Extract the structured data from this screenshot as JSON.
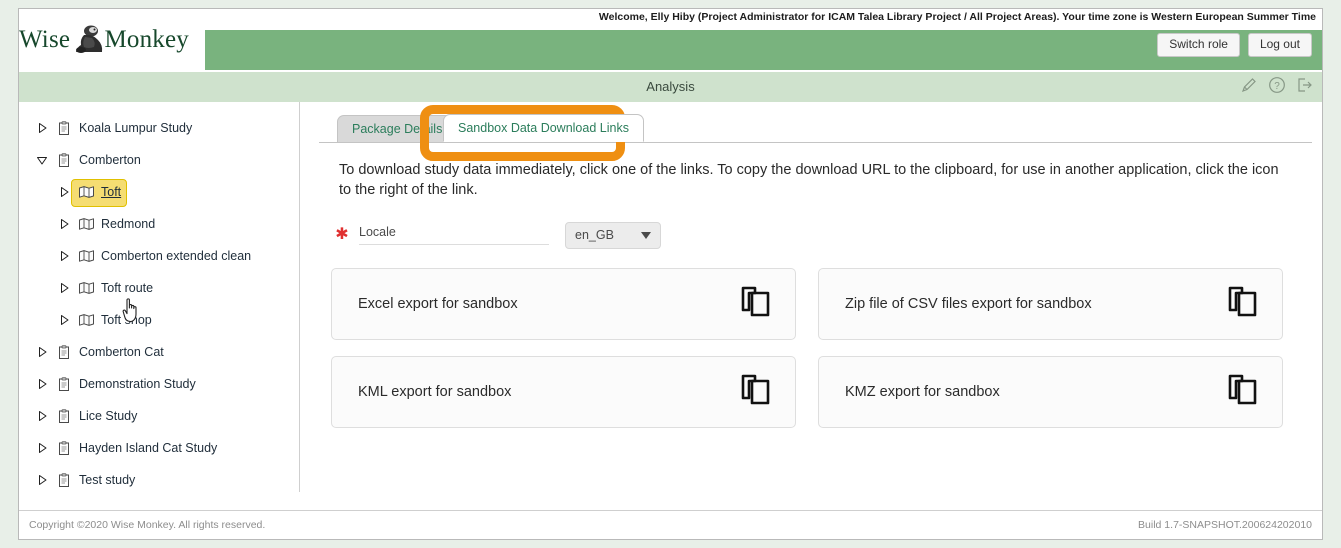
{
  "brand": {
    "name_part1": "Wise",
    "name_part2": "Monkey",
    "logo_icon": "monkey-logo-icon"
  },
  "header": {
    "welcome_text": "Welcome, Elly Hiby (Project Administrator for ICAM Talea Library Project / All Project Areas). Your time zone is Western European Summer Time",
    "switch_role_label": "Switch role",
    "log_out_label": "Log out",
    "green_color": "#79b37e"
  },
  "title_bar": {
    "title": "Analysis",
    "background_color": "#cfe2cd",
    "icons": [
      {
        "name": "edit-pencil-icon"
      },
      {
        "name": "help-question-icon"
      },
      {
        "name": "exit-arrow-icon"
      }
    ]
  },
  "sidebar": {
    "items": [
      {
        "label": "Koala Lumpur Study",
        "level": 1,
        "expanded": false,
        "icon": "study-clipboard-icon",
        "selected": false
      },
      {
        "label": "Comberton",
        "level": 1,
        "expanded": true,
        "icon": "study-clipboard-icon",
        "selected": false
      },
      {
        "label": "Toft",
        "level": 2,
        "expanded": false,
        "icon": "map-package-icon",
        "selected": true
      },
      {
        "label": "Redmond",
        "level": 2,
        "expanded": false,
        "icon": "map-package-icon",
        "selected": false
      },
      {
        "label": "Comberton extended clean",
        "level": 2,
        "expanded": false,
        "icon": "map-package-icon",
        "selected": false
      },
      {
        "label": "Toft route",
        "level": 2,
        "expanded": false,
        "icon": "map-package-icon",
        "selected": false
      },
      {
        "label": "Toft shop",
        "level": 2,
        "expanded": false,
        "icon": "map-package-icon",
        "selected": false
      },
      {
        "label": "Comberton Cat",
        "level": 1,
        "expanded": false,
        "icon": "study-clipboard-icon",
        "selected": false
      },
      {
        "label": "Demonstration Study",
        "level": 1,
        "expanded": false,
        "icon": "study-clipboard-icon",
        "selected": false
      },
      {
        "label": "Lice Study",
        "level": 1,
        "expanded": false,
        "icon": "study-clipboard-icon",
        "selected": false
      },
      {
        "label": "Hayden Island Cat Study",
        "level": 1,
        "expanded": false,
        "icon": "study-clipboard-icon",
        "selected": false
      },
      {
        "label": "Test study",
        "level": 1,
        "expanded": false,
        "icon": "study-clipboard-icon",
        "selected": false
      }
    ],
    "selection_color": "#f5dd72",
    "cursor": "pointing-hand-cursor"
  },
  "tabs": {
    "inactive_label": "Package Details",
    "active_label": "Sandbox Data Download Links",
    "highlight_color": "#ef8f12"
  },
  "main": {
    "instructions": "To download study data immediately, click one of the links. To copy the download URL to the clipboard, for use in another application, click the icon to the right of the link.",
    "locale": {
      "required_marker": "✱",
      "label": "Locale",
      "value": "en_GB"
    },
    "download_cards": [
      {
        "label": "Excel export for sandbox",
        "icon": "copy-icon"
      },
      {
        "label": "Zip file of CSV files export for sandbox",
        "icon": "copy-icon"
      },
      {
        "label": "KML export for sandbox",
        "icon": "copy-icon"
      },
      {
        "label": "KMZ export for sandbox",
        "icon": "copy-icon"
      }
    ]
  },
  "footer": {
    "copyright": "Copyright ©2020 Wise Monkey. All rights reserved.",
    "build": "Build 1.7-SNAPSHOT.200624202010"
  }
}
